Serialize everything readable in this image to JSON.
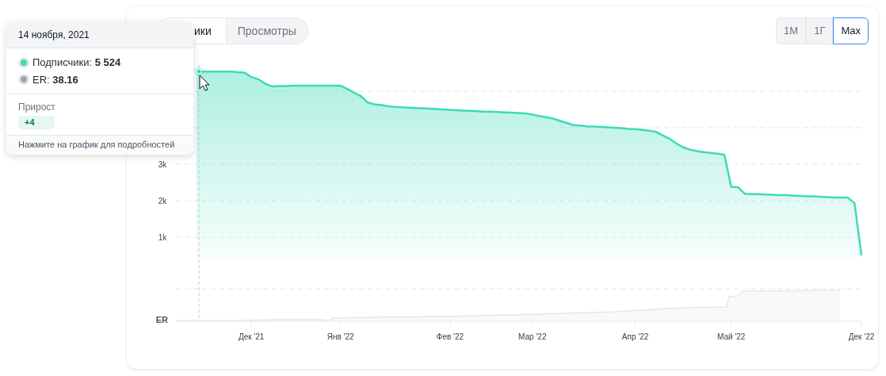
{
  "tabs": [
    {
      "label": "ики",
      "selected": true
    },
    {
      "label": "Просмотры",
      "selected": false
    }
  ],
  "ranges": [
    {
      "label": "1M",
      "selected": false
    },
    {
      "label": "1Г",
      "selected": false
    },
    {
      "label": "Max",
      "selected": true
    }
  ],
  "chart": {
    "er_label": "ER",
    "chart_data": {
      "type": "area",
      "categories": [
        null,
        null,
        null,
        null,
        null,
        null,
        null,
        null,
        null,
        null,
        null,
        "Дек '21",
        null,
        null,
        null,
        null,
        null,
        null,
        null,
        null,
        null,
        null,
        null,
        null,
        "Янв '22",
        null,
        null,
        null,
        null,
        null,
        null,
        null,
        null,
        null,
        null,
        null,
        null,
        null,
        null,
        null,
        "Фев '22",
        null,
        null,
        null,
        null,
        null,
        null,
        null,
        null,
        null,
        null,
        null,
        "Мар '22",
        null,
        null,
        null,
        null,
        null,
        null,
        null,
        null,
        null,
        null,
        null,
        null,
        null,
        null,
        "Апр '22",
        null,
        null,
        null,
        null,
        null,
        null,
        null,
        null,
        null,
        null,
        null,
        null,
        null,
        "Май '22",
        null,
        null,
        null,
        null,
        null,
        null,
        null,
        null,
        null,
        null,
        null,
        null,
        null,
        null,
        null,
        null,
        null,
        null,
        "Дек '22"
      ],
      "series": [
        {
          "color": "#3ddbb8",
          "values": [
            null,
            null,
            null,
            5550,
            5540,
            5540,
            5540,
            5540,
            5540,
            5520,
            5510,
            5390,
            5330,
            5210,
            5130,
            5140,
            5140,
            5150,
            5150,
            5150,
            5150,
            5150,
            5150,
            5150,
            5150,
            5060,
            4960,
            4860,
            4690,
            4640,
            4620,
            4590,
            4570,
            4560,
            4550,
            4540,
            4530,
            4520,
            4510,
            4500,
            4490,
            4480,
            4470,
            4460,
            4450,
            4440,
            4440,
            4430,
            4420,
            4410,
            4400,
            4390,
            4360,
            4320,
            4290,
            4250,
            4190,
            4130,
            4070,
            4060,
            4040,
            4030,
            4020,
            4010,
            4000,
            3990,
            3970,
            3960,
            3940,
            3920,
            3890,
            3790,
            3700,
            3570,
            3460,
            3400,
            3360,
            3330,
            3310,
            3290,
            3260,
            2380,
            2370,
            2190,
            2180,
            2180,
            2170,
            2160,
            2150,
            2150,
            2140,
            2130,
            2120,
            2120,
            2110,
            2100,
            2090,
            2090,
            2090,
            1930,
            500
          ]
        }
      ],
      "grid": true,
      "ylim": [
        0,
        5700
      ],
      "yticks": [
        {
          "value": 1000,
          "label": "1k"
        },
        {
          "value": 2000,
          "label": "2k"
        },
        {
          "value": 3000,
          "label": "3k"
        }
      ]
    }
  },
  "tooltip": {
    "date": "14 ноября, 2021",
    "rows": [
      {
        "text": "Подписчики: **5 524**",
        "color": "#3ddbb8"
      },
      {
        "text": "ER: **38.16**",
        "color": "#9ca3af"
      }
    ],
    "growth_label": "Прирост",
    "growth_value": "+4",
    "hint": "Нажмите на график для подробностей"
  }
}
